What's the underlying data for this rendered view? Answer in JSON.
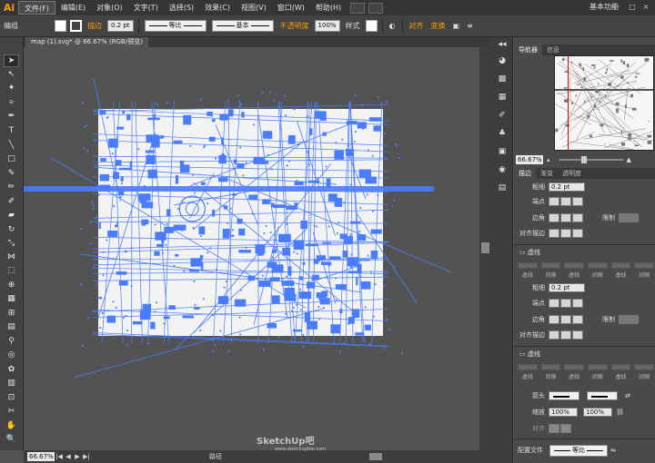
{
  "app": {
    "logo": "Ai",
    "workspace": "基本功能",
    "window_controls": [
      "–",
      "□",
      "×"
    ]
  },
  "menu": [
    {
      "label": "文件(F)",
      "active": true
    },
    {
      "label": "编辑(E)"
    },
    {
      "label": "对象(O)"
    },
    {
      "label": "文字(T)"
    },
    {
      "label": "选择(S)"
    },
    {
      "label": "效果(C)"
    },
    {
      "label": "视图(V)"
    },
    {
      "label": "窗口(W)"
    },
    {
      "label": "帮助(H)"
    }
  ],
  "control_bar": {
    "mode": "编组",
    "stroke_label": "描边",
    "stroke_weight": "0.2 pt",
    "stroke_profile": "等比",
    "brush": "基本",
    "opacity_label": "不透明度",
    "opacity": "100%",
    "style_label": "样式",
    "align_label": "对齐",
    "transform_label": "变换"
  },
  "document": {
    "tab": "map (1).svg* @ 66.67% (RGB/预览)",
    "zoom": "66.67%",
    "status": "路径"
  },
  "watermark": {
    "title": "SketchUp吧",
    "url": "www.sketchupbar.com"
  },
  "navigator": {
    "tabs": [
      "导航器",
      "信息"
    ],
    "zoom": "66.67%"
  },
  "stroke_panel": {
    "tabs": [
      "描边",
      "渐变",
      "透明度"
    ],
    "weight_label": "粗细",
    "weight": "0.2 pt",
    "cap_label": "端点",
    "corner_label": "边角",
    "limit_label": "限制",
    "align_label": "对齐描边",
    "dash_label": "虚线",
    "dash_fields": [
      "虚线",
      "间隙",
      "虚线",
      "间隙",
      "虚线",
      "间隙"
    ],
    "arrow_label": "箭头",
    "scale_label": "缩放",
    "scale_values": [
      "100%",
      "100%"
    ],
    "align2_label": "对齐",
    "profile_label": "配置文件",
    "profile": "等比"
  },
  "colors": {
    "selection": "#4a7cff",
    "artboard": "#f4f3f3",
    "canvas": "#535353",
    "accent": "#ff9a00"
  }
}
